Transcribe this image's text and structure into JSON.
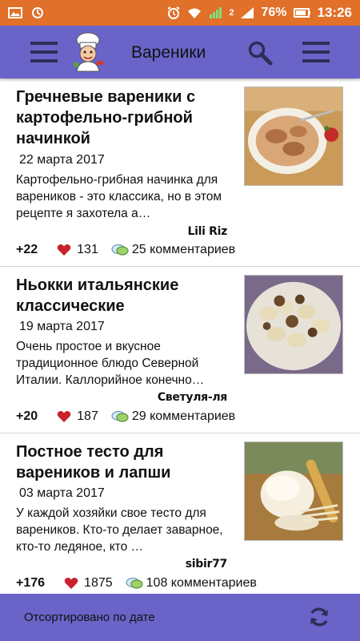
{
  "status_bar": {
    "battery": "76%",
    "time": "13:26",
    "sim_badge": "2"
  },
  "app_bar": {
    "title": "Вареники",
    "left_icon": "menu-icon",
    "logo": "chef-logo",
    "search_icon": "search-icon",
    "right_icon": "menu-icon"
  },
  "recipes": [
    {
      "title": "Гречневые вареники с картофельно-грибной начинкой",
      "date": "22 марта 2017",
      "description": "Картофельно-грибная начинка для вареников - это классика, но в этом рецепте я захотела а…",
      "author": "Lili Riz",
      "likes": "+22",
      "views": "131",
      "comments": "25 комментариев"
    },
    {
      "title": "Ньокки итальянские классические",
      "date": "19 марта 2017",
      "description": "Очень простое и вкусное традиционное блюдо Северной Италии. Каллорийное конечно…",
      "author": "Светуля-ля",
      "likes": "+20",
      "views": "187",
      "comments": "29 комментариев"
    },
    {
      "title": "Постное тесто для вареников и лапши",
      "date": "03 марта 2017",
      "description": "У каждой хозяйки свое тесто для вареников. Кто-то делает заварное, кто-то ледяное, кто …",
      "author": "sibir77",
      "likes": "+176",
      "views": "1875",
      "comments": "108 комментариев"
    }
  ],
  "bottom_bar": {
    "sort_label": "Отсортировано по дате",
    "refresh_icon": "refresh-icon"
  },
  "colors": {
    "status_bar": "#e0702a",
    "app_bar": "#6a64c9",
    "bottom_bar": "#6a64c9",
    "heart": "#c8232d",
    "bubble": "#9fd06a"
  }
}
